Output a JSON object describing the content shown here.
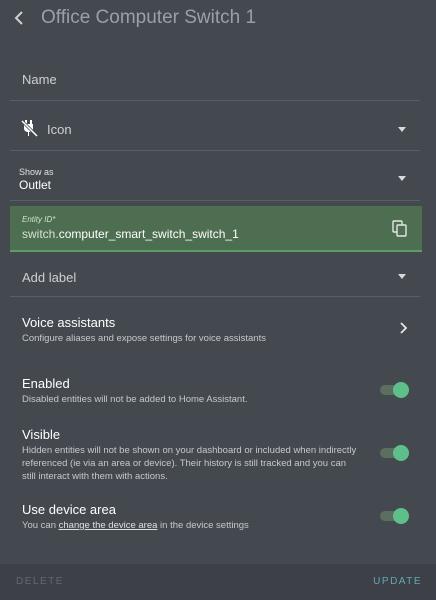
{
  "header": {
    "title": "Office Computer Switch 1"
  },
  "name": {
    "placeholder": "Name"
  },
  "icon": {
    "label": "Icon",
    "icon_name": "power-plug-off-icon"
  },
  "show_as": {
    "label": "Show as",
    "value": "Outlet"
  },
  "entity_id": {
    "label": "Entity ID*",
    "prefix": "switch.",
    "value": "computer_smart_switch_switch_1"
  },
  "label": {
    "placeholder": "Add label"
  },
  "voice": {
    "title": "Voice assistants",
    "description": "Configure aliases and expose settings for voice assistants"
  },
  "enabled": {
    "title": "Enabled",
    "description": "Disabled entities will not be added to Home Assistant.",
    "on": true
  },
  "visible": {
    "title": "Visible",
    "description": "Hidden entities will not be shown on your dashboard or included when indirectly referenced (ie via an area or device). Their history is still tracked and you can still interact with them with actions.",
    "on": true
  },
  "device_area": {
    "title": "Use device area",
    "desc_before": "You can ",
    "desc_link": "change the device area",
    "desc_after": " in the device settings",
    "on": true
  },
  "footer": {
    "delete_label": "DELETE",
    "update_label": "UPDATE"
  },
  "colors": {
    "background": "#444950",
    "accent": "#5fbf8a",
    "entity_bg": "#4d6e51",
    "update": "#63a9b2"
  }
}
